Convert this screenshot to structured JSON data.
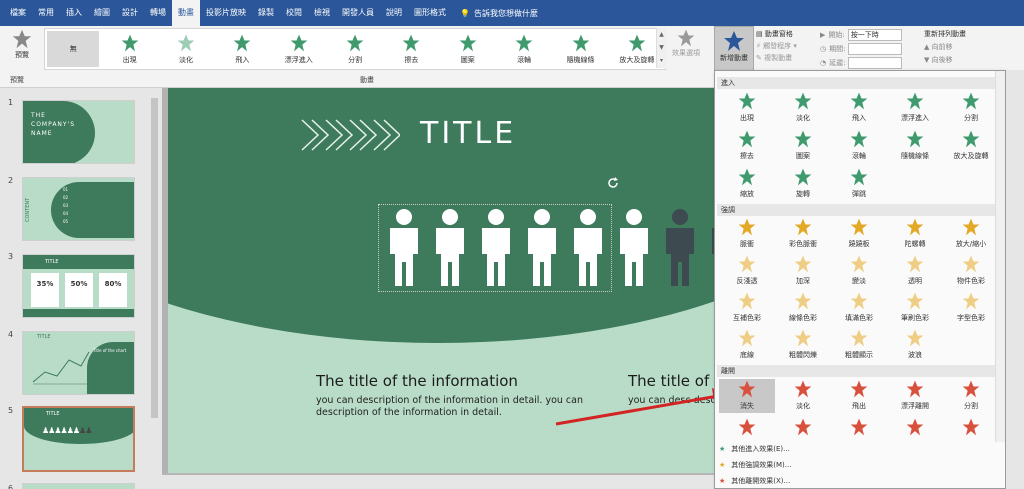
{
  "menu": [
    "檔案",
    "常用",
    "插入",
    "繪圖",
    "設計",
    "轉場",
    "動畫",
    "投影片放映",
    "錄製",
    "校閱",
    "檢視",
    "開發人員",
    "說明",
    "圖形格式"
  ],
  "active_menu": "動畫",
  "tell_me": "告訴我您想做什麼",
  "ribbon": {
    "preview_label": "預覽",
    "preview_group": "預覽",
    "none_label": "無",
    "gallery": [
      "出現",
      "淡化",
      "飛入",
      "漂浮進入",
      "分割",
      "擦去",
      "圖案",
      "滾輪",
      "隨機線條",
      "放大及旋轉"
    ],
    "effect_options": "效果選項",
    "animation_group": "動畫",
    "add_animation": "新增動畫",
    "animation_pane": "動畫窗格",
    "trigger": "觸發程序",
    "copy_animation": "複製動畫",
    "start_label": "開始:",
    "start_value": "按一下時",
    "duration_label": "期間:",
    "delay_label": "延遲:",
    "reorder_title": "重新排列動畫",
    "move_earlier": "向前移",
    "move_later": "向後移"
  },
  "slides": {
    "numbers": [
      "1",
      "2",
      "3",
      "4",
      "5",
      "6"
    ],
    "s1": {
      "line1": "THE",
      "line2": "COMPANY'S",
      "line3": "NAME"
    },
    "s2": {
      "side": "CONTENT",
      "items": [
        "01",
        "02",
        "03",
        "04",
        "05"
      ]
    },
    "s3": {
      "title": "TITLE",
      "v1": "35%",
      "v2": "50%",
      "v3": "80%"
    },
    "s4": {
      "title": "TITLE",
      "sub": "Title of the chart"
    },
    "s5": {
      "title": "TITLE"
    }
  },
  "slide": {
    "title": "TITLE",
    "info_title": "The title of the information",
    "info_body": "you can description of the information in detail. you can description of the information in detail.",
    "info_title_2": "The title of",
    "info_body_2": "you can desc description of"
  },
  "dropdown": {
    "entrance_header": "進入",
    "entrance": [
      "出現",
      "淡化",
      "飛入",
      "漂浮進入",
      "分割",
      "擦去",
      "圖案",
      "滾輪",
      "隨機線條",
      "放大及旋轉",
      "縮放",
      "旋轉",
      "彈跳"
    ],
    "emphasis_header": "強調",
    "emphasis": [
      "脈衝",
      "彩色脈衝",
      "蹺蹺板",
      "陀螺轉",
      "放大/縮小",
      "反淺透",
      "加深",
      "變淡",
      "透明",
      "物件色彩",
      "互補色彩",
      "線條色彩",
      "填滿色彩",
      "筆刷色彩",
      "字型色彩",
      "底線",
      "粗體閃爍",
      "粗體顯示",
      "波浪"
    ],
    "exit_header": "離開",
    "exit": [
      "消失",
      "淡化",
      "飛出",
      "漂浮離開",
      "分割"
    ],
    "more_entrance": "其他進入效果(E)...",
    "more_emphasis": "其他強調效果(M)...",
    "more_exit": "其他離開效果(X)..."
  },
  "colors": {
    "entrance": "#3f9a6e",
    "emphasis": "#e3a825",
    "exit": "#d9513c",
    "dark_green": "#3e7a5c",
    "light_green": "#b8dcc8"
  }
}
